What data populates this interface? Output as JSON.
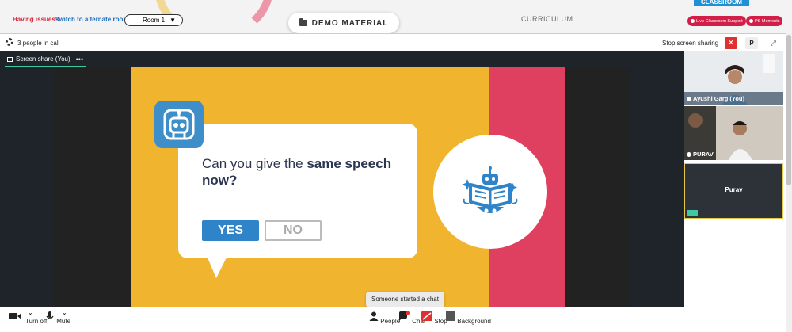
{
  "topbar": {
    "issues_text": "Having issues?",
    "switch_link": "switch to alternate room",
    "room_value": "Room 1",
    "demo_material": "DEMO MATERIAL",
    "curriculum": "CURRICULUM",
    "classroom_tab": "CLASSROOM",
    "live_support": "Live Classroom Support",
    "ps_moments": "PS Moments"
  },
  "callbar": {
    "people_count": "3 people in call",
    "stop_screen_sharing": "Stop screen sharing",
    "close_symbol": "✕",
    "p_label": "P",
    "expand_symbol": "⤢"
  },
  "stage": {
    "share_label": "Screen share (You)",
    "more_symbol": "•••",
    "question_prefix": "Can you give the ",
    "question_bold": "same speech",
    "question_suffix": "now?",
    "yes": "YES",
    "no": "NO"
  },
  "participants": [
    {
      "name": "Ayushi Garg (You)"
    },
    {
      "name": "PURAV"
    },
    {
      "name": "Purav"
    }
  ],
  "bottombar": {
    "turn_off": "Turn off",
    "mute": "Mute",
    "people": "People",
    "chat": "Chat",
    "stop": "Stop",
    "background": "Background",
    "chat_badge": "0",
    "toast": "Someone started a chat"
  },
  "colors": {
    "slide_yellow": "#f0b42e",
    "slide_red": "#e0405f",
    "accent_blue": "#2f84c9",
    "stop_red": "#e03131"
  }
}
